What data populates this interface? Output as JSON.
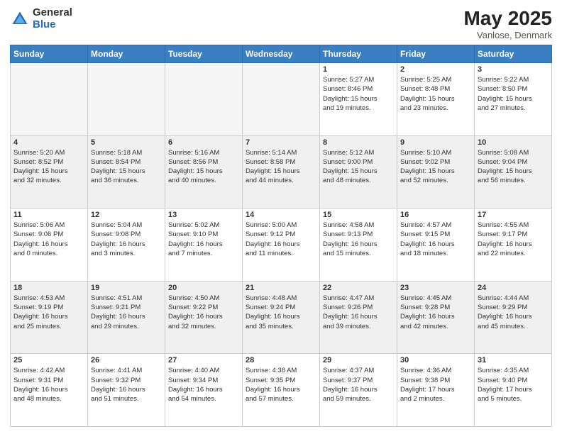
{
  "logo": {
    "general": "General",
    "blue": "Blue"
  },
  "title": "May 2025",
  "subtitle": "Vanlose, Denmark",
  "days_header": [
    "Sunday",
    "Monday",
    "Tuesday",
    "Wednesday",
    "Thursday",
    "Friday",
    "Saturday"
  ],
  "weeks": [
    [
      {
        "day": "",
        "info": "",
        "empty": true
      },
      {
        "day": "",
        "info": "",
        "empty": true
      },
      {
        "day": "",
        "info": "",
        "empty": true
      },
      {
        "day": "",
        "info": "",
        "empty": true
      },
      {
        "day": "1",
        "info": "Sunrise: 5:27 AM\nSunset: 8:46 PM\nDaylight: 15 hours\nand 19 minutes."
      },
      {
        "day": "2",
        "info": "Sunrise: 5:25 AM\nSunset: 8:48 PM\nDaylight: 15 hours\nand 23 minutes."
      },
      {
        "day": "3",
        "info": "Sunrise: 5:22 AM\nSunset: 8:50 PM\nDaylight: 15 hours\nand 27 minutes."
      }
    ],
    [
      {
        "day": "4",
        "info": "Sunrise: 5:20 AM\nSunset: 8:52 PM\nDaylight: 15 hours\nand 32 minutes."
      },
      {
        "day": "5",
        "info": "Sunrise: 5:18 AM\nSunset: 8:54 PM\nDaylight: 15 hours\nand 36 minutes."
      },
      {
        "day": "6",
        "info": "Sunrise: 5:16 AM\nSunset: 8:56 PM\nDaylight: 15 hours\nand 40 minutes."
      },
      {
        "day": "7",
        "info": "Sunrise: 5:14 AM\nSunset: 8:58 PM\nDaylight: 15 hours\nand 44 minutes."
      },
      {
        "day": "8",
        "info": "Sunrise: 5:12 AM\nSunset: 9:00 PM\nDaylight: 15 hours\nand 48 minutes."
      },
      {
        "day": "9",
        "info": "Sunrise: 5:10 AM\nSunset: 9:02 PM\nDaylight: 15 hours\nand 52 minutes."
      },
      {
        "day": "10",
        "info": "Sunrise: 5:08 AM\nSunset: 9:04 PM\nDaylight: 15 hours\nand 56 minutes."
      }
    ],
    [
      {
        "day": "11",
        "info": "Sunrise: 5:06 AM\nSunset: 9:06 PM\nDaylight: 16 hours\nand 0 minutes."
      },
      {
        "day": "12",
        "info": "Sunrise: 5:04 AM\nSunset: 9:08 PM\nDaylight: 16 hours\nand 3 minutes."
      },
      {
        "day": "13",
        "info": "Sunrise: 5:02 AM\nSunset: 9:10 PM\nDaylight: 16 hours\nand 7 minutes."
      },
      {
        "day": "14",
        "info": "Sunrise: 5:00 AM\nSunset: 9:12 PM\nDaylight: 16 hours\nand 11 minutes."
      },
      {
        "day": "15",
        "info": "Sunrise: 4:58 AM\nSunset: 9:13 PM\nDaylight: 16 hours\nand 15 minutes."
      },
      {
        "day": "16",
        "info": "Sunrise: 4:57 AM\nSunset: 9:15 PM\nDaylight: 16 hours\nand 18 minutes."
      },
      {
        "day": "17",
        "info": "Sunrise: 4:55 AM\nSunset: 9:17 PM\nDaylight: 16 hours\nand 22 minutes."
      }
    ],
    [
      {
        "day": "18",
        "info": "Sunrise: 4:53 AM\nSunset: 9:19 PM\nDaylight: 16 hours\nand 25 minutes."
      },
      {
        "day": "19",
        "info": "Sunrise: 4:51 AM\nSunset: 9:21 PM\nDaylight: 16 hours\nand 29 minutes."
      },
      {
        "day": "20",
        "info": "Sunrise: 4:50 AM\nSunset: 9:22 PM\nDaylight: 16 hours\nand 32 minutes."
      },
      {
        "day": "21",
        "info": "Sunrise: 4:48 AM\nSunset: 9:24 PM\nDaylight: 16 hours\nand 35 minutes."
      },
      {
        "day": "22",
        "info": "Sunrise: 4:47 AM\nSunset: 9:26 PM\nDaylight: 16 hours\nand 39 minutes."
      },
      {
        "day": "23",
        "info": "Sunrise: 4:45 AM\nSunset: 9:28 PM\nDaylight: 16 hours\nand 42 minutes."
      },
      {
        "day": "24",
        "info": "Sunrise: 4:44 AM\nSunset: 9:29 PM\nDaylight: 16 hours\nand 45 minutes."
      }
    ],
    [
      {
        "day": "25",
        "info": "Sunrise: 4:42 AM\nSunset: 9:31 PM\nDaylight: 16 hours\nand 48 minutes."
      },
      {
        "day": "26",
        "info": "Sunrise: 4:41 AM\nSunset: 9:32 PM\nDaylight: 16 hours\nand 51 minutes."
      },
      {
        "day": "27",
        "info": "Sunrise: 4:40 AM\nSunset: 9:34 PM\nDaylight: 16 hours\nand 54 minutes."
      },
      {
        "day": "28",
        "info": "Sunrise: 4:38 AM\nSunset: 9:35 PM\nDaylight: 16 hours\nand 57 minutes."
      },
      {
        "day": "29",
        "info": "Sunrise: 4:37 AM\nSunset: 9:37 PM\nDaylight: 16 hours\nand 59 minutes."
      },
      {
        "day": "30",
        "info": "Sunrise: 4:36 AM\nSunset: 9:38 PM\nDaylight: 17 hours\nand 2 minutes."
      },
      {
        "day": "31",
        "info": "Sunrise: 4:35 AM\nSunset: 9:40 PM\nDaylight: 17 hours\nand 5 minutes."
      }
    ]
  ]
}
